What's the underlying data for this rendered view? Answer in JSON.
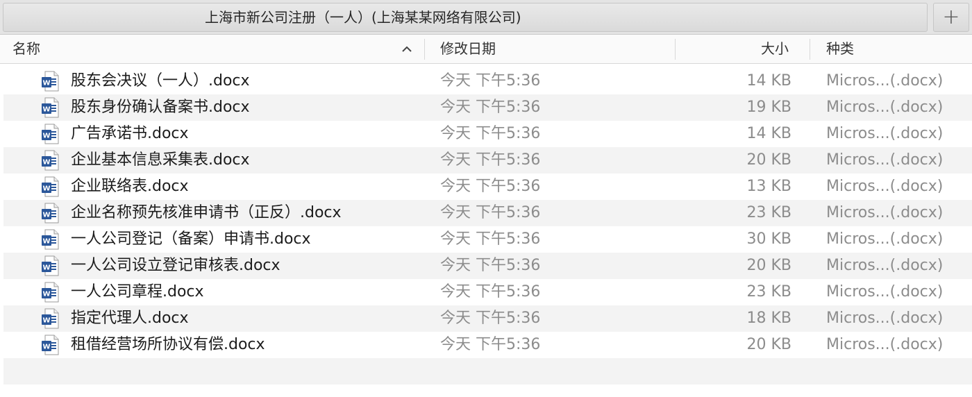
{
  "window": {
    "tab_title": "上海市新公司注册（一人）(上海某某网络有限公司)",
    "new_tab_symbol": "+"
  },
  "columns": {
    "name": "名称",
    "date": "修改日期",
    "size": "大小",
    "kind": "种类"
  },
  "files": [
    {
      "name": "股东会决议（一人）.docx",
      "date": "今天 下午5:36",
      "size": "14 KB",
      "kind": "Micros...(.docx)"
    },
    {
      "name": "股东身份确认备案书.docx",
      "date": "今天 下午5:36",
      "size": "19 KB",
      "kind": "Micros...(.docx)"
    },
    {
      "name": "广告承诺书.docx",
      "date": "今天 下午5:36",
      "size": "14 KB",
      "kind": "Micros...(.docx)"
    },
    {
      "name": "企业基本信息采集表.docx",
      "date": "今天 下午5:36",
      "size": "20 KB",
      "kind": "Micros...(.docx)"
    },
    {
      "name": "企业联络表.docx",
      "date": "今天 下午5:36",
      "size": "13 KB",
      "kind": "Micros...(.docx)"
    },
    {
      "name": "企业名称预先核准申请书（正反）.docx",
      "date": "今天 下午5:36",
      "size": "23 KB",
      "kind": "Micros...(.docx)"
    },
    {
      "name": "一人公司登记（备案）申请书.docx",
      "date": "今天 下午5:36",
      "size": "30 KB",
      "kind": "Micros...(.docx)"
    },
    {
      "name": "一人公司设立登记审核表.docx",
      "date": "今天 下午5:36",
      "size": "20 KB",
      "kind": "Micros...(.docx)"
    },
    {
      "name": "一人公司章程.docx",
      "date": "今天 下午5:36",
      "size": "23 KB",
      "kind": "Micros...(.docx)"
    },
    {
      "name": "指定代理人.docx",
      "date": "今天 下午5:36",
      "size": "18 KB",
      "kind": "Micros...(.docx)"
    },
    {
      "name": "租借经营场所协议有偿.docx",
      "date": "今天 下午5:36",
      "size": "20 KB",
      "kind": "Micros...(.docx)"
    }
  ],
  "icons": {
    "file": "word-document-icon",
    "sort": "chevron-up-icon",
    "new_tab": "plus-icon"
  },
  "colors": {
    "word_blue": "#2b579a",
    "alt_row": "#f3f3f3",
    "secondary_text": "#8c8c8c"
  }
}
